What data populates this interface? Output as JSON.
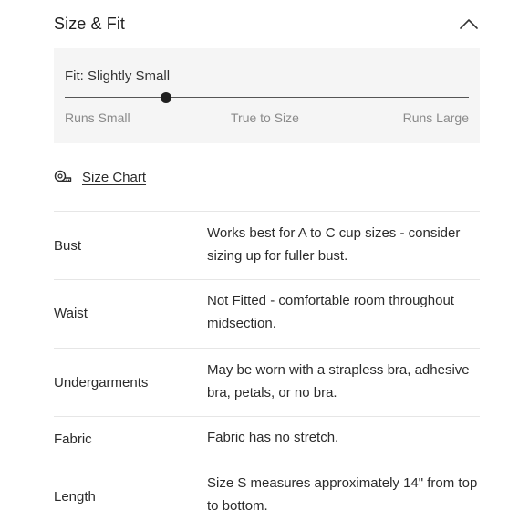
{
  "section": {
    "title": "Size & Fit",
    "collapse_icon": "chevron-up-icon"
  },
  "fit": {
    "label": "Fit: Slightly Small",
    "scale": [
      "Runs Small",
      "True to Size",
      "Runs Large"
    ],
    "position_fraction": 0.25
  },
  "size_chart": {
    "icon": "measuring-tape-icon",
    "label": "Size Chart"
  },
  "specs": [
    {
      "label": "Bust",
      "value": "Works best for A to C cup sizes - consider sizing up for fuller bust."
    },
    {
      "label": "Waist",
      "value": "Not Fitted - comfortable room throughout midsection."
    },
    {
      "label": "Undergarments",
      "value": "May be worn with a strapless bra, adhesive bra, petals, or no bra."
    },
    {
      "label": "Fabric",
      "value": "Fabric has no stretch."
    },
    {
      "label": "Length",
      "value": "Size S measures approximately 14\" from top to bottom."
    }
  ]
}
